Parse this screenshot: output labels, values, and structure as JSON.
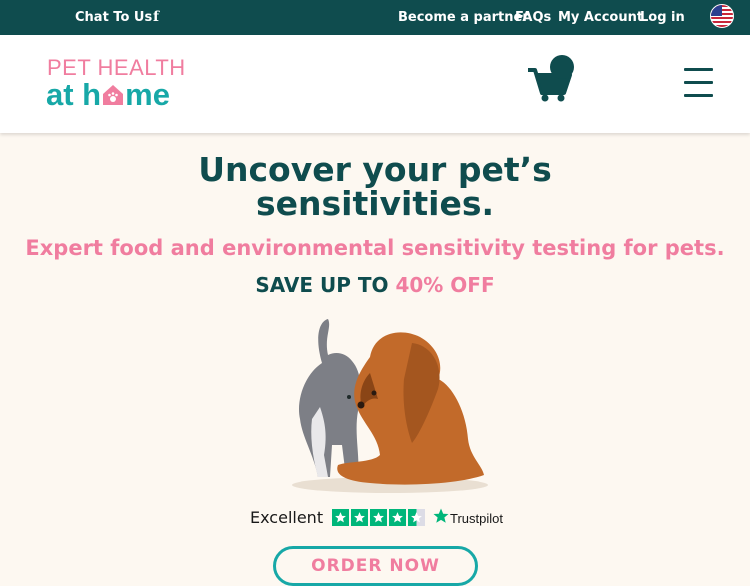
{
  "topbar": {
    "chat_label": "Chat To Us",
    "facebook_glyph": "f",
    "partner_label": "Become a partner",
    "faqs_label": "FAQs",
    "account_label": "My Account",
    "login_label": "Log in",
    "flag_icon": "us-flag-icon",
    "background_color": "#0f4c4e"
  },
  "header": {
    "logo_line1": "PET HEALTH",
    "logo_line2_a": "at h",
    "logo_line2_b": "me",
    "cart_icon": "shopping-cart-icon",
    "menu_icon": "hamburger-menu-icon"
  },
  "hero": {
    "title_line1": "Uncover your pet’s",
    "title_line2": "sensitivities.",
    "subtitle": "Expert food and environmental sensitivity testing for pets.",
    "save_prefix": "SAVE UP TO",
    "save_value": "40% OFF",
    "image_alt": "cat-and-dog-image"
  },
  "trust": {
    "rating_label": "Excellent",
    "stars": 4.5,
    "brand": "Trustpilot"
  },
  "cta": {
    "order_label": "ORDER NOW"
  },
  "colors": {
    "brand_teal": "#17a8a7",
    "brand_dark": "#0f4c4e",
    "brand_pink": "#f07d9f",
    "page_bg": "#fdf8f1"
  }
}
